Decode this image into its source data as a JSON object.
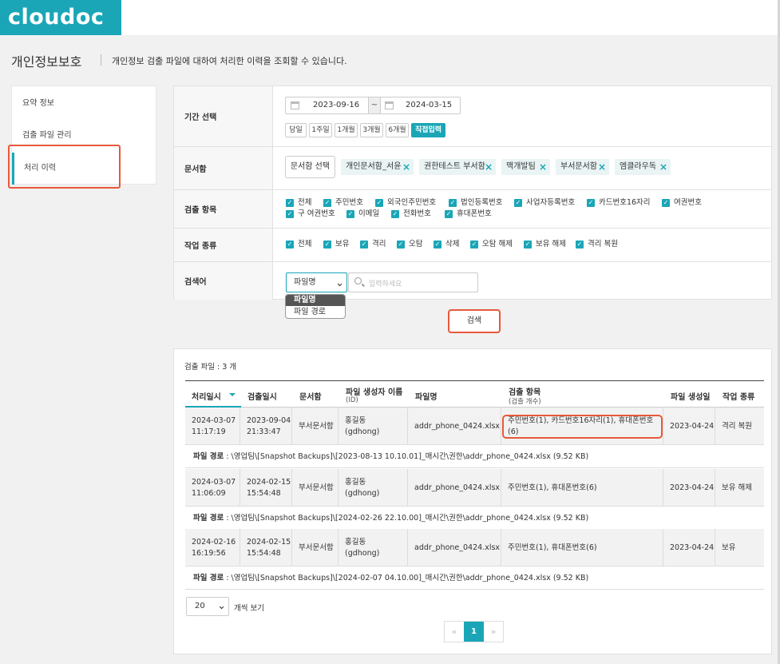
{
  "app": {
    "logo_text": "cloudoc"
  },
  "page": {
    "title": "개인정보보호",
    "description": "개인정보 검출 파일에 대하여 처리한 이력을 조회할 수 있습니다."
  },
  "sidebar": {
    "items": [
      {
        "label": "요약 정보"
      },
      {
        "label": "검출 파일 관리"
      },
      {
        "label": "처리 이력",
        "active": true
      }
    ]
  },
  "filters": {
    "period": {
      "label": "기간 선택",
      "start_date": "2023-09-16",
      "separator": "~",
      "end_date": "2024-03-15",
      "quick_buttons": [
        "당일",
        "1주일",
        "1개월",
        "3개월",
        "6개월",
        "직접입력"
      ],
      "active_quick": "직접입력"
    },
    "folder": {
      "label": "문서함",
      "select_button": "문서함 선택",
      "chips": [
        "개인문서함_서윤",
        "권한테스트 부서함",
        "맥개발팀",
        "부서문서함",
        "엠클라우독"
      ]
    },
    "items": {
      "label": "검출 항목",
      "options": [
        "전체",
        "주민번호",
        "외국인주민번호",
        "법인등록번호",
        "사업자등록번호",
        "카드번호16자리",
        "여권번호",
        "구 여권번호",
        "이메일",
        "전화번호",
        "휴대폰번호"
      ]
    },
    "actions": {
      "label": "작업 종류",
      "options": [
        "전체",
        "보유",
        "격리",
        "오탐",
        "삭제",
        "오탐 해제",
        "보유 해제",
        "격리 복원"
      ]
    },
    "keyword": {
      "label": "검색어",
      "select_value": "파일명",
      "placeholder": "입력하세요",
      "dropdown_options": [
        "파일명",
        "파일 경로"
      ]
    },
    "search_button": "검색"
  },
  "results": {
    "count_text": "검출 파일 : 3 개",
    "columns": {
      "processed_at": "처리일시",
      "detected_at": "검출일시",
      "folder": "문서함",
      "creator": "파일 생성자 이름",
      "creator_sub": "(ID)",
      "filename": "파일명",
      "items": "검출 항목",
      "items_sub": "(검출 개수)",
      "created_date": "파일 생성일",
      "action": "작업 종류"
    },
    "rows": [
      {
        "processed_at": "2024-03-07\n11:17:19",
        "detected_at": "2023-09-04\n21:33:47",
        "folder": "부서문서함",
        "creator": "홍길동\n(gdhong)",
        "filename": "addr_phone_0424.xlsx",
        "items": "주민번호(1), 카드번호16자리(1), 휴대폰번호(6)",
        "created_date": "2023-04-24",
        "action": "격리 복원",
        "path_label": "파일 경로",
        "path": ": \\영업팀\\[Snapshot Backups]\\[2023-08-13 10.10.01]_매시간\\권한\\addr_phone_0424.xlsx (9.52 KB)"
      },
      {
        "processed_at": "2024-03-07\n11:06:09",
        "detected_at": "2024-02-15\n15:54:48",
        "folder": "부서문서함",
        "creator": "홍길동\n(gdhong)",
        "filename": "addr_phone_0424.xlsx",
        "items": "주민번호(1), 휴대폰번호(6)",
        "created_date": "2023-04-24",
        "action": "보유 해제",
        "path_label": "파일 경로",
        "path": ": \\영업팀\\[Snapshot Backups]\\[2024-02-26 22.10.00]_매시간\\권한\\addr_phone_0424.xlsx (9.52 KB)"
      },
      {
        "processed_at": "2024-02-16\n16:19:56",
        "detected_at": "2024-02-15\n15:54:48",
        "folder": "부서문서함",
        "creator": "홍길동\n(gdhong)",
        "filename": "addr_phone_0424.xlsx",
        "items": "주민번호(1), 휴대폰번호(6)",
        "created_date": "2023-04-24",
        "action": "보유",
        "path_label": "파일 경로",
        "path": ": \\영업팀\\[Snapshot Backups]\\[2024-02-07 04.10.00]_매시간\\권한\\addr_phone_0424.xlsx (9.52 KB)"
      }
    ],
    "per_page": "20",
    "per_page_label": "개씩 보기",
    "pagination": {
      "prev": "«",
      "current": "1",
      "next": "»"
    }
  },
  "colors": {
    "accent": "#1aa6b7",
    "highlight": "#e8593a"
  }
}
